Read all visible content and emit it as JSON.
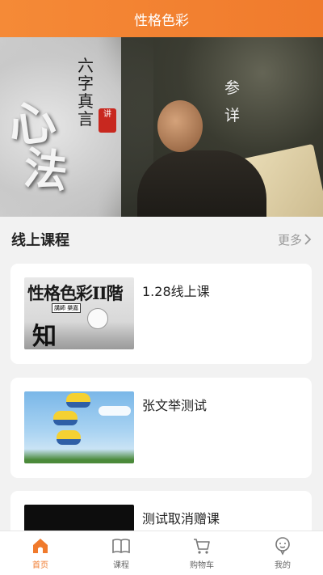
{
  "header": {
    "title": "性格色彩"
  },
  "banner": {
    "calligraphy_1": "心",
    "calligraphy_2": "法",
    "subtitle": "六字真言",
    "seal": "讲",
    "side_text": "参详"
  },
  "section": {
    "title": "线上课程",
    "more_label": "更多"
  },
  "courses": [
    {
      "title": "1.28线上课",
      "thumb_text_main": "性格色彩II階",
      "thumb_text_tag": "講師 樂嘉",
      "thumb_text_char": "知"
    },
    {
      "title": "张文举测试"
    },
    {
      "title": "测试取消赠课"
    }
  ],
  "tabbar": {
    "items": [
      {
        "label": "首页",
        "icon": "home-icon",
        "active": true
      },
      {
        "label": "课程",
        "icon": "book-icon",
        "active": false
      },
      {
        "label": "购物车",
        "icon": "cart-icon",
        "active": false
      },
      {
        "label": "我的",
        "icon": "profile-icon",
        "active": false
      }
    ],
    "active_color": "#f07a2c",
    "inactive_color": "#666666"
  },
  "colors": {
    "brand": "#f07a2c"
  }
}
